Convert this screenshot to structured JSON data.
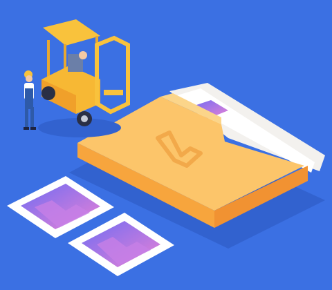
{
  "colors": {
    "background": "#3b70e3",
    "folder_top": "#fcc366",
    "folder_side": "#f5a23c",
    "forklift": "#f9c23c",
    "photo_gradient_start": "#7a6cf0",
    "photo_gradient_end": "#e47fd8"
  },
  "icons": [
    "forklift-icon",
    "worker-icon",
    "folder-icon",
    "wps-logo-icon",
    "photo-icon"
  ]
}
